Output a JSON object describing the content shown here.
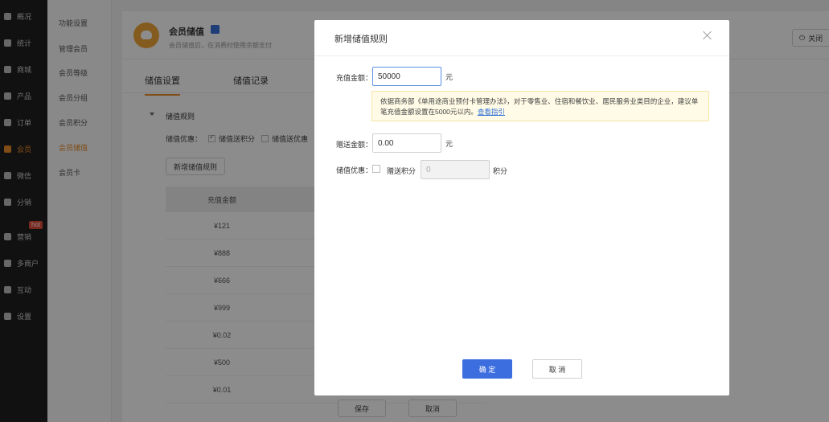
{
  "nav": {
    "items": [
      {
        "label": "概况",
        "icon": "overview-icon"
      },
      {
        "label": "统计",
        "icon": "stats-icon"
      },
      {
        "label": "商城",
        "icon": "mall-icon"
      },
      {
        "label": "产品",
        "icon": "product-icon"
      },
      {
        "label": "订单",
        "icon": "order-icon"
      },
      {
        "label": "会员",
        "icon": "member-icon"
      },
      {
        "label": "微信",
        "icon": "wechat-icon"
      },
      {
        "label": "分销",
        "icon": "distribution-icon"
      },
      {
        "label": "营销",
        "icon": "marketing-icon"
      },
      {
        "label": "多商户",
        "icon": "merchant-icon"
      },
      {
        "label": "互动",
        "icon": "interact-icon"
      },
      {
        "label": "设置",
        "icon": "settings-icon"
      }
    ],
    "hot_badge": "hot",
    "active_color": "#e98a2a"
  },
  "subnav": {
    "items": [
      "功能设置",
      "管理会员",
      "会员等级",
      "会员分组",
      "会员积分",
      "会员储值",
      "会员卡"
    ]
  },
  "header": {
    "title": "会员储值",
    "subtitle": "会员储值后，在消费时使用余额支付",
    "close_label": "关闭"
  },
  "tabs": [
    "储值设置",
    "储值记录"
  ],
  "section": {
    "title": "储值规则",
    "option_label": "储值优惠：",
    "option1": "储值送积分",
    "option2": "储值送优惠",
    "add_rule": "新增储值规则"
  },
  "table": {
    "header": [
      "充值金额"
    ],
    "rows": [
      "¥121",
      "¥888",
      "¥666",
      "¥999",
      "¥0.02",
      "¥500",
      "¥0.01"
    ]
  },
  "footer": {
    "save": "保存",
    "cancel": "取消"
  },
  "modal": {
    "title": "新增储值规则",
    "recharge_label": "充值金额：",
    "recharge_value": "50000",
    "unit_yuan": "元",
    "notice_text": "依据商务部《单用途商业预付卡管理办法》，对于零售业、住宿和餐饮业、居民服务业类目的企业，建议单笔充值金额设置在5000元以内。",
    "notice_link": "查看指引",
    "gift_label": "赠送金额：",
    "gift_value": "0.00",
    "discount_label": "储值优惠：",
    "points_label": "赠送积分",
    "points_value": "0",
    "points_unit": "积分",
    "ok": "确 定",
    "cancel": "取 消",
    "primary_color": "#3c6ee0"
  }
}
